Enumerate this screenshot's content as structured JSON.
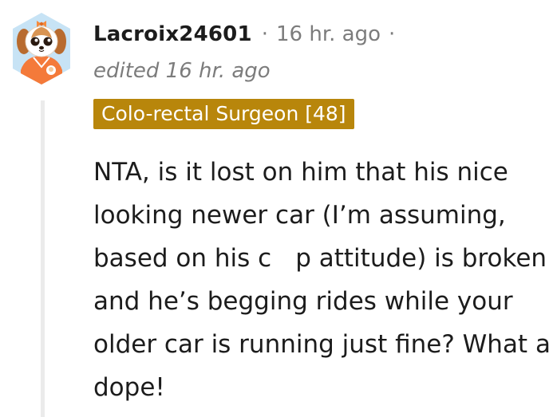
{
  "comment": {
    "username": "Lacroix24601",
    "separator": "·",
    "timestamp": "16 hr. ago",
    "edited": "edited 16 hr. ago",
    "flair": "Colo-rectal Surgeon [48]",
    "body_before": "NTA, is it lost on him that his nice looking newer car (I’m assuming, based on his c",
    "body_after": "p attitude) is broken and he’s begging rides while your older car is running just fine? What a dope!"
  },
  "colors": {
    "flair_bg": "#b8860b",
    "muted_text": "#7c7c7c",
    "thread_line": "#ebebeb"
  },
  "avatar": {
    "icon": "puppy-avatar-icon"
  }
}
